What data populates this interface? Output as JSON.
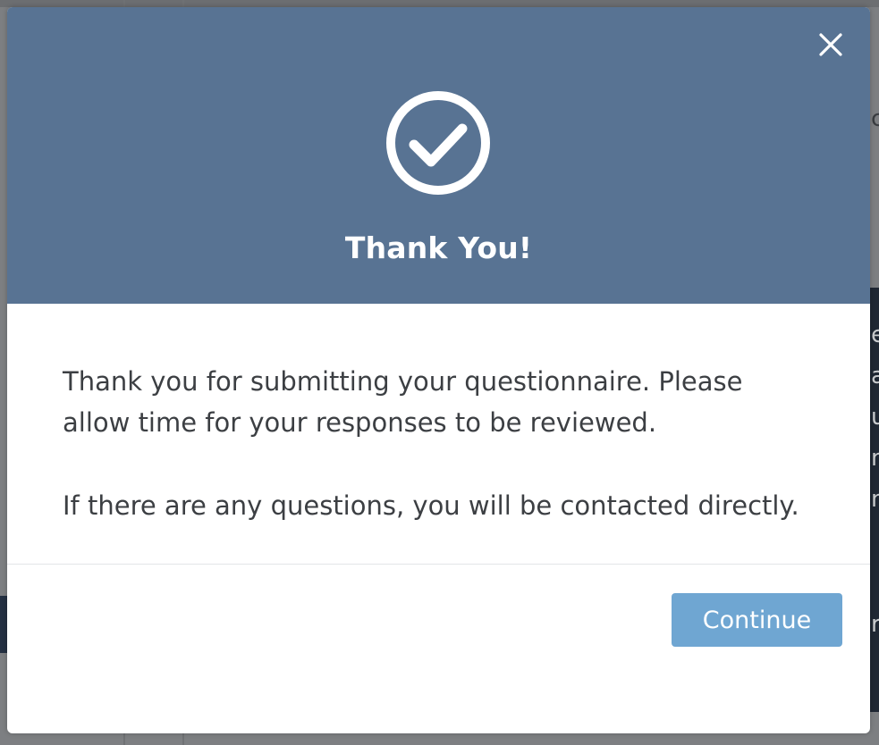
{
  "background": {
    "peek_top": "c",
    "peek_side": [
      "e",
      "a",
      "u",
      "n",
      "n",
      "r"
    ]
  },
  "modal": {
    "title": "Thank You!",
    "header_color": "#587393",
    "icon": "check-circle-icon",
    "close_icon": "close-icon",
    "body": {
      "paragraph_1": "Thank you for submitting your questionnaire. Please allow time for your responses to be reviewed.",
      "paragraph_2": "If there are any questions, you will be contacted directly."
    },
    "footer": {
      "continue_label": "Continue",
      "button_color": "#6fa6d2"
    }
  }
}
